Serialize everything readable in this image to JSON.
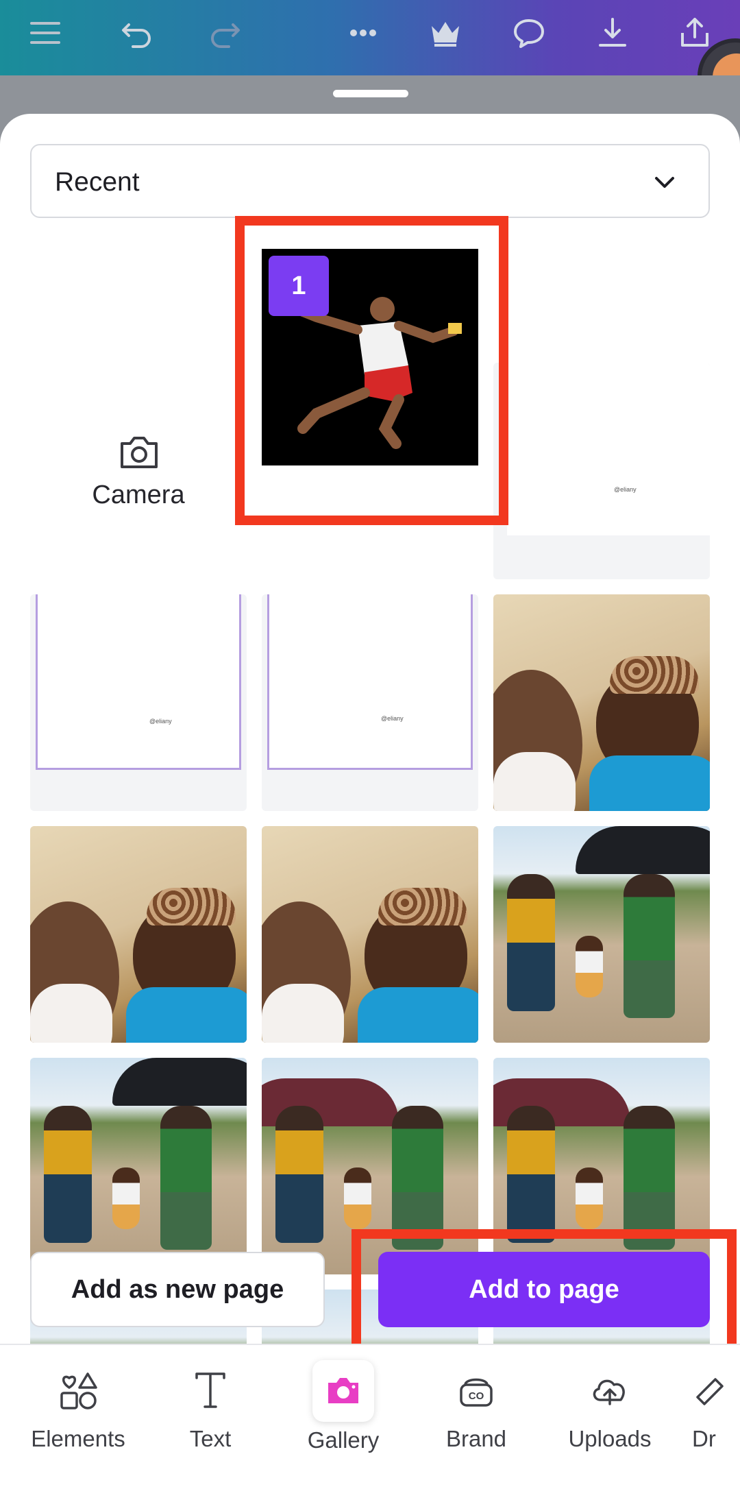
{
  "toolbar": {
    "icons": [
      "menu-icon",
      "undo-icon",
      "redo-icon",
      "more-icon",
      "crown-icon",
      "comment-icon",
      "download-icon",
      "share-icon"
    ]
  },
  "picker": {
    "source_label": "Recent",
    "camera_label": "Camera",
    "selected_count": "1",
    "watermark": "@eliany"
  },
  "actions": {
    "add_as_new_page": "Add as new page",
    "add_to_page": "Add to page"
  },
  "bottom_nav": {
    "items": [
      {
        "label": "Elements",
        "icon": "elements-icon"
      },
      {
        "label": "Text",
        "icon": "text-icon"
      },
      {
        "label": "Gallery",
        "icon": "gallery-camera-icon"
      },
      {
        "label": "Brand",
        "icon": "brand-icon"
      },
      {
        "label": "Uploads",
        "icon": "uploads-icon"
      },
      {
        "label": "Dr",
        "icon": "draw-icon"
      }
    ],
    "active": "Gallery"
  },
  "colors": {
    "accent": "#7b2ff5",
    "highlight": "#f2381f",
    "gallery_icon": "#e83ec4"
  }
}
